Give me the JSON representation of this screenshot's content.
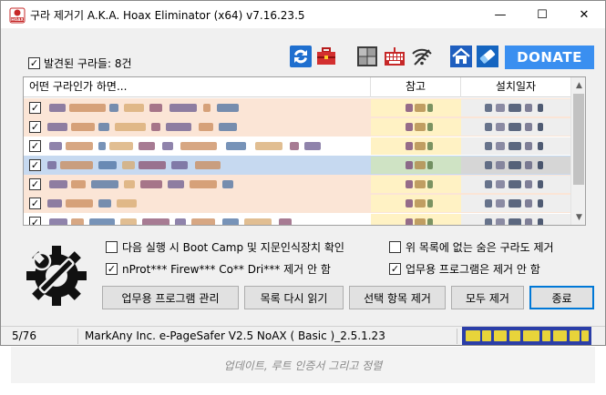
{
  "window": {
    "title": "구라 제거기 A.K.A. Hoax Eliminator (x64) v7.16.23.5",
    "min_glyph": "—",
    "max_glyph": "☐",
    "close_glyph": "✕"
  },
  "found": {
    "checked": true,
    "label": "발견된 구라들: 8건"
  },
  "toolbar": {
    "icons": [
      "refresh-icon",
      "toolbox-icon",
      "windows-icon",
      "keyboard-icon",
      "wifi-icon",
      "home-icon",
      "eraser-icon"
    ],
    "donate_label": "DONATE"
  },
  "list": {
    "columns": [
      "어떤 구라인가 하면...",
      "참고",
      "설치일자"
    ],
    "rows": [
      {
        "checked": true,
        "style": "peach"
      },
      {
        "checked": true,
        "style": "peach"
      },
      {
        "checked": true,
        "style": "white"
      },
      {
        "checked": true,
        "style": "selected"
      },
      {
        "checked": true,
        "style": "peach"
      },
      {
        "checked": true,
        "style": "peach"
      },
      {
        "checked": true,
        "style": "white"
      }
    ],
    "scroll_up": "▲",
    "scroll_down": "▼"
  },
  "options": {
    "boot_camp": {
      "checked": false,
      "label": "다음 실행 시 Boot Camp 및 지문인식장치 확인"
    },
    "not_in_list": {
      "checked": false,
      "label": "위 목록에 없는 숨은 구라도 제거"
    },
    "nprot": {
      "checked": true,
      "label": "nProt*** Firew*** Co** Dri*** 제거 안 함"
    },
    "business": {
      "checked": true,
      "label": "업무용 프로그램은 제거 안 함"
    }
  },
  "buttons": {
    "manage": "업무용 프로그램 관리",
    "reload": "목록 다시 읽기",
    "remove_selected": "선택 항목 제거",
    "remove_all": "모두 제거",
    "exit": "종료"
  },
  "status": {
    "count": "5/76",
    "text": "MarkAny Inc. e-PageSafer V2.5 NoAX ( Basic )_2.5.1.23"
  },
  "hint": "업데이트, 루트 인증서 그리고 정렬",
  "colors": {
    "peach": "#fbe5d6",
    "selected": "#c6d9f0",
    "ref_col": "#fff2c4",
    "date_col": "#eeeeee",
    "donate": "#3a8ff0"
  }
}
